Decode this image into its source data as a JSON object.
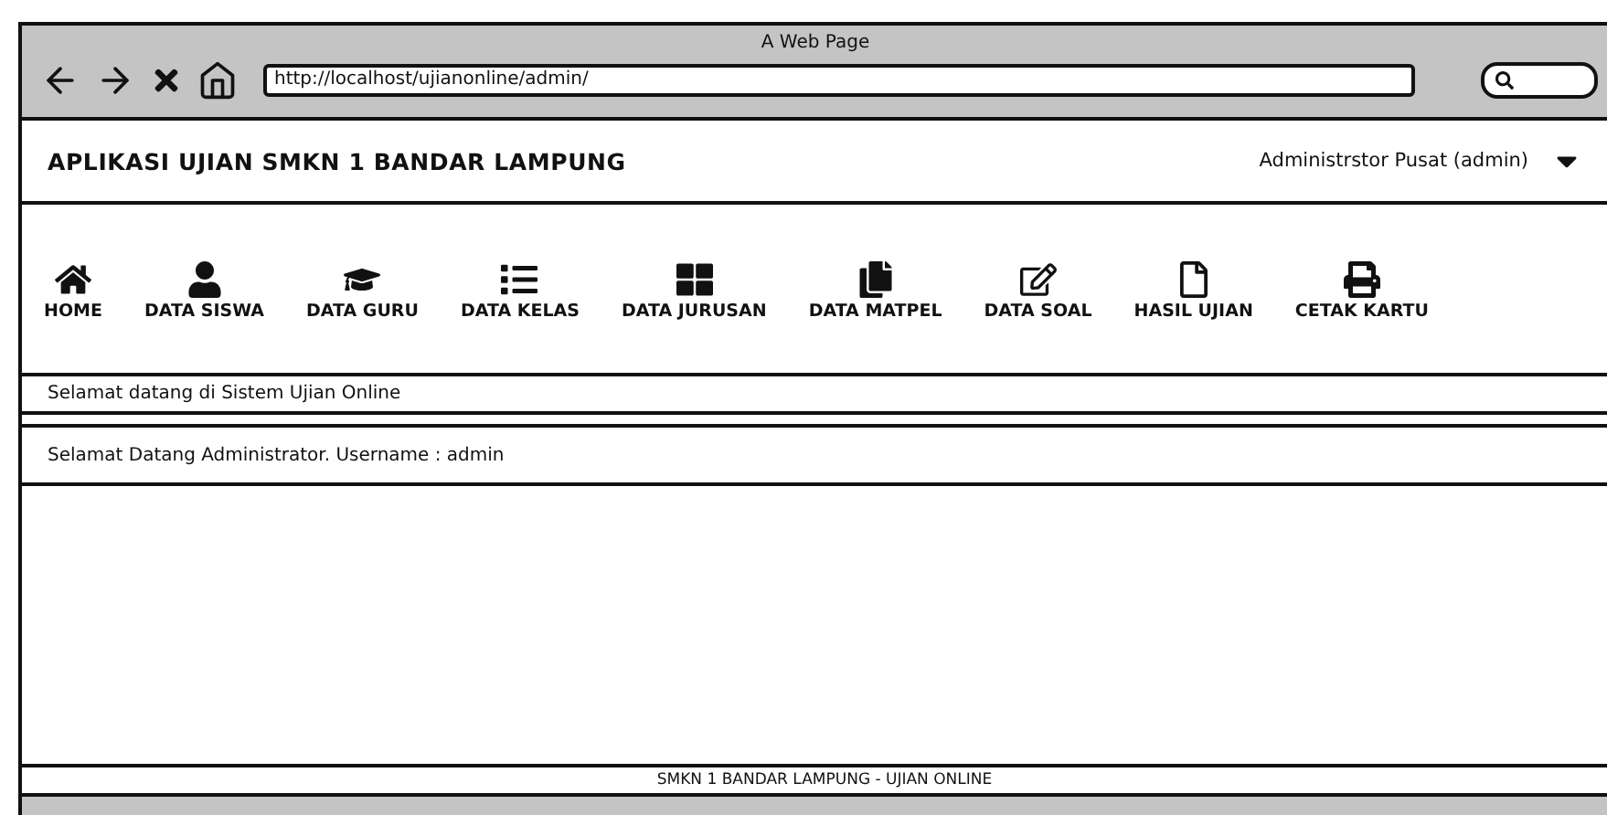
{
  "browser": {
    "title": "A Web Page",
    "url": "http://localhost/ujianonline/admin/"
  },
  "header": {
    "app_title": "APLIKASI UJIAN SMKN 1 BANDAR LAMPUNG",
    "user_menu": "Administrstor Pusat (admin)"
  },
  "nav": [
    {
      "label": "HOME",
      "kind": "home"
    },
    {
      "label": "DATA SISWA",
      "kind": "user"
    },
    {
      "label": "DATA GURU",
      "kind": "cap"
    },
    {
      "label": "DATA KELAS",
      "kind": "list"
    },
    {
      "label": "DATA JURUSAN",
      "kind": "grid"
    },
    {
      "label": "DATA MATPEL",
      "kind": "copy"
    },
    {
      "label": "DATA SOAL",
      "kind": "edit"
    },
    {
      "label": "HASIL UJIAN",
      "kind": "file"
    },
    {
      "label": "CETAK KARTU",
      "kind": "print"
    }
  ],
  "welcome_bar": "Selamat datang di Sistem Ujian Online",
  "greeting": "Selamat Datang Administrator. Username : admin",
  "footer": "SMKN 1 BANDAR LAMPUNG - UJIAN ONLINE"
}
